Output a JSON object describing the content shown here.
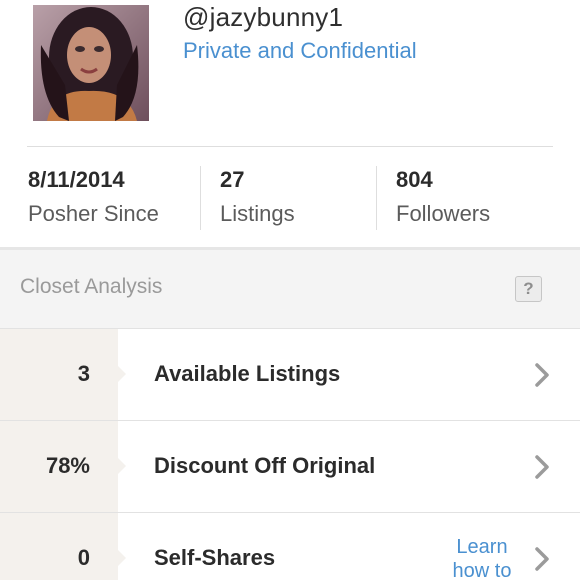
{
  "profile": {
    "username": "@jazybunny1",
    "subtitle": "Private and Confidential",
    "avatar_icon": "profile-photo"
  },
  "stats": [
    {
      "value": "8/11/2014",
      "label": "Posher Since"
    },
    {
      "value": "27",
      "label": "Listings"
    },
    {
      "value": "804",
      "label": "Followers"
    }
  ],
  "closet_analysis": {
    "title": "Closet Analysis",
    "help_label": "?",
    "rows": [
      {
        "value": "3",
        "label": "Available Listings"
      },
      {
        "value": "78%",
        "label": "Discount Off Original"
      },
      {
        "value": "0",
        "label": "Self-Shares",
        "link_line1": "Learn",
        "link_line2": "how to"
      }
    ]
  },
  "colors": {
    "link": "#4a90d0",
    "metric_bg": "#f4f1ed",
    "section_bg": "#f4f4f4"
  }
}
